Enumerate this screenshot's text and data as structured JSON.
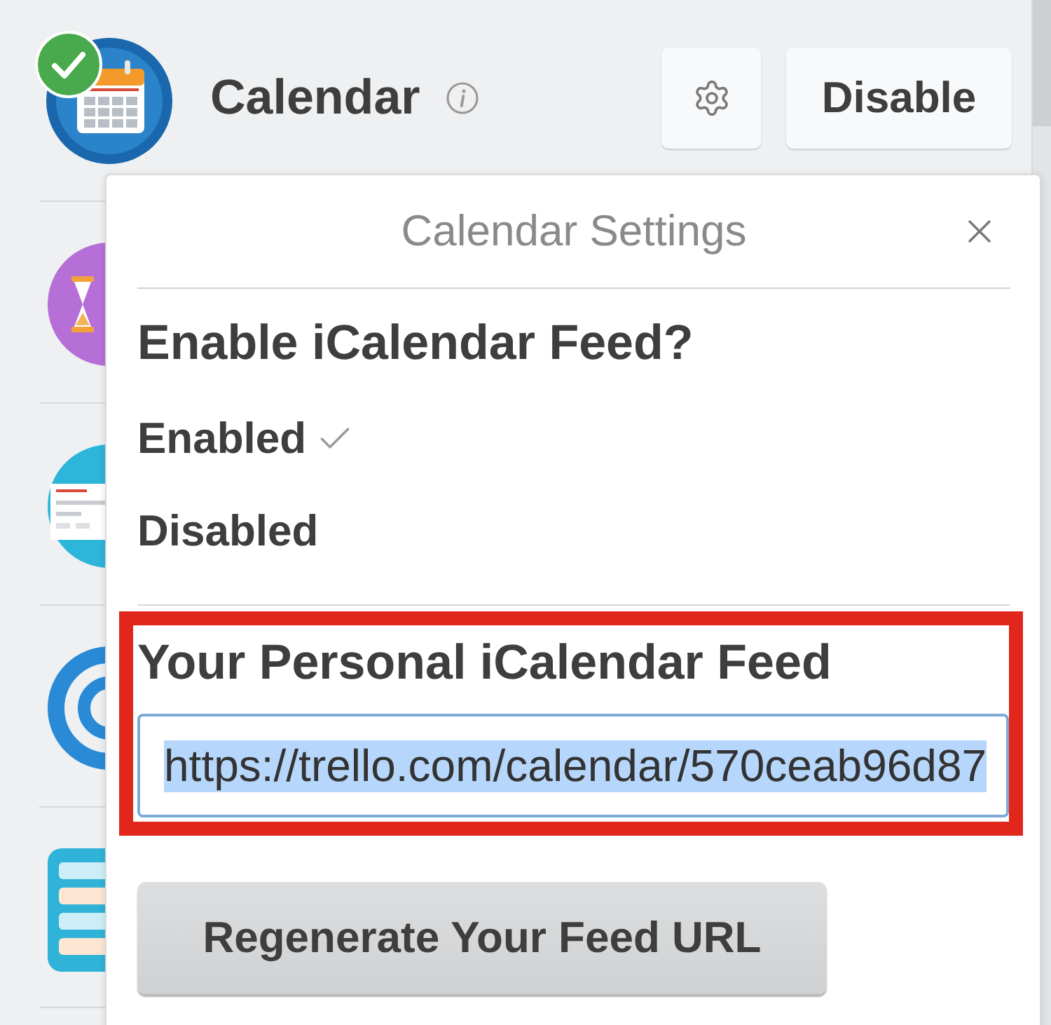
{
  "app": {
    "name": "Calendar",
    "enabled": true
  },
  "toolbar": {
    "disable_button": "Disable"
  },
  "settings_popover": {
    "title": "Calendar Settings",
    "question": "Enable iCalendar Feed?",
    "options": [
      {
        "label": "Enabled",
        "selected": true
      },
      {
        "label": "Disabled",
        "selected": false
      }
    ],
    "feed": {
      "label": "Your Personal iCalendar Feed",
      "value": "https://trello.com/calendar/570ceab96d87",
      "text_selected": true,
      "highlighted": true
    },
    "regenerate_button": "Regenerate Your Feed URL"
  }
}
